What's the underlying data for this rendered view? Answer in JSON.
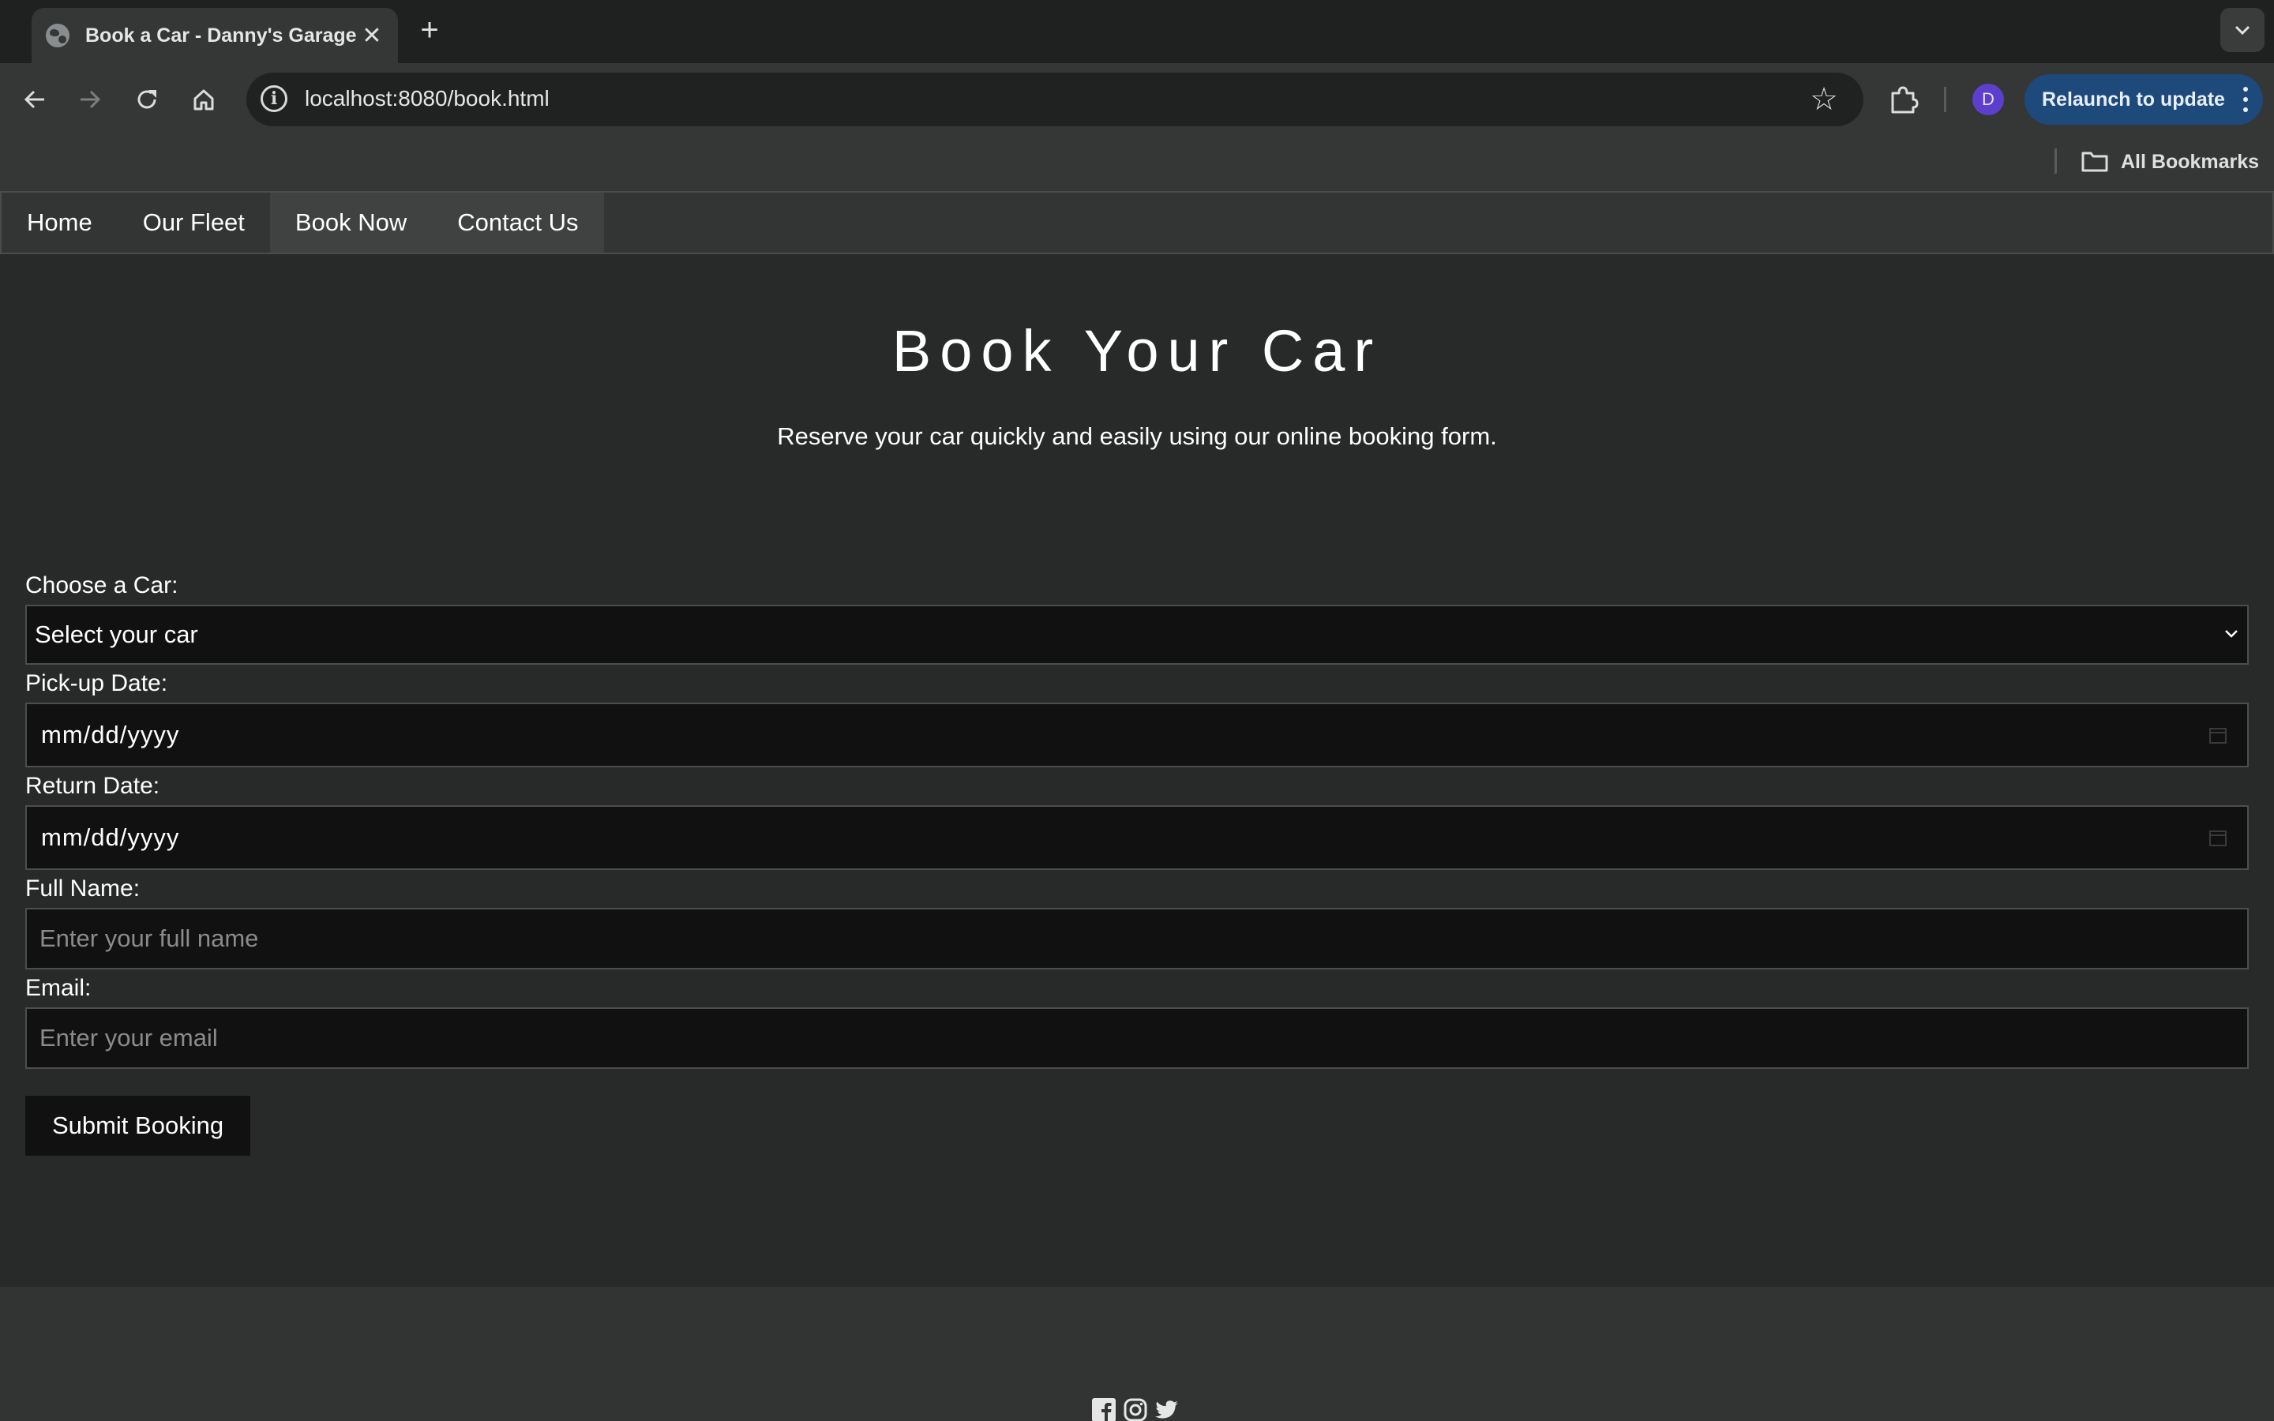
{
  "browser": {
    "tab_title": "Book a Car - Danny's Garage",
    "tab_close": "✕",
    "new_tab": "+",
    "url": "localhost:8080/book.html",
    "info_glyph": "i",
    "star_glyph": "☆",
    "avatar_initial": "D",
    "relaunch_label": "Relaunch to update",
    "bookmarks_label": "All Bookmarks",
    "icons": [
      "favicon-globe-icon",
      "back-icon",
      "forward-icon",
      "reload-icon",
      "home-icon",
      "site-info-icon",
      "star-icon",
      "extensions-icon",
      "more-menu-icon",
      "folder-icon",
      "tab-search-icon"
    ]
  },
  "nav": {
    "items": [
      {
        "label": "Home"
      },
      {
        "label": "Our Fleet"
      },
      {
        "label": "Book Now"
      },
      {
        "label": "Contact Us"
      }
    ]
  },
  "main": {
    "title": "Book Your Car",
    "subtitle": "Reserve your car quickly and easily using our online booking form."
  },
  "form": {
    "car_label": "Choose a Car:",
    "car_value": "Select your car",
    "pickup_label": "Pick-up Date:",
    "pickup_value": "mm/dd/yyyy",
    "return_label": "Return Date:",
    "return_value": "mm/dd/yyyy",
    "name_label": "Full Name:",
    "name_placeholder": "Enter your full name",
    "email_label": "Email:",
    "email_placeholder": "Enter your email",
    "submit_label": "Submit Booking"
  },
  "footer": {
    "social_icons": [
      "facebook-icon",
      "instagram-icon",
      "twitter-icon"
    ]
  },
  "colors": {
    "page_bg": "#282a2a",
    "nav_bg": "#333434",
    "field_bg": "#111111",
    "relaunch_bg": "#1d4a7a",
    "avatar_bg": "#5c3fcc"
  }
}
